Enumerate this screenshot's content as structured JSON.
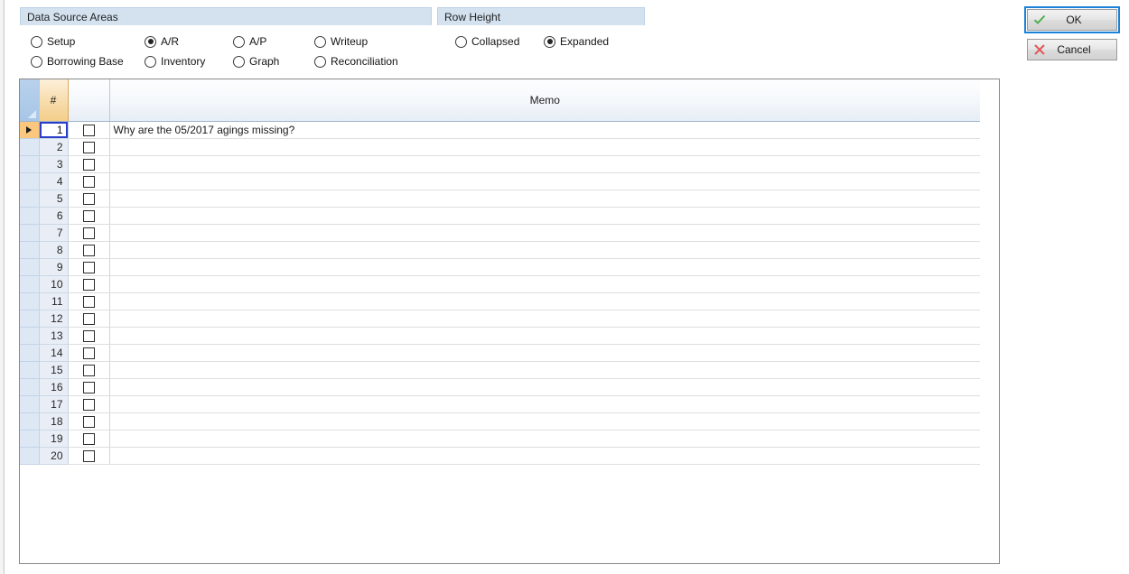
{
  "groups": {
    "data_source": {
      "caption": "Data Source Areas",
      "options": [
        {
          "label": "Setup",
          "checked": false
        },
        {
          "label": "A/R",
          "checked": true
        },
        {
          "label": "A/P",
          "checked": false
        },
        {
          "label": "Writeup",
          "checked": false
        },
        {
          "label": "Borrowing Base",
          "checked": false
        },
        {
          "label": "Inventory",
          "checked": false
        },
        {
          "label": "Graph",
          "checked": false
        },
        {
          "label": "Reconciliation",
          "checked": false
        }
      ]
    },
    "row_height": {
      "caption": "Row Height",
      "options": [
        {
          "label": "Collapsed",
          "checked": false
        },
        {
          "label": "Expanded",
          "checked": true
        }
      ]
    }
  },
  "buttons": {
    "ok": {
      "label": "OK",
      "icon": "check-icon",
      "icon_glyph": "✓",
      "icon_color": "#4caf50",
      "focused": true
    },
    "cancel": {
      "label": "Cancel",
      "icon": "x-icon",
      "icon_glyph": "✕",
      "icon_color": "#e0585b",
      "focused": false
    }
  },
  "grid": {
    "columns": [
      {
        "key": "indicator",
        "header": ""
      },
      {
        "key": "number",
        "header": "#"
      },
      {
        "key": "checkbox",
        "header": ""
      },
      {
        "key": "memo",
        "header": "Memo"
      }
    ],
    "current_row": 1,
    "rows": [
      {
        "number": "1",
        "checked": false,
        "memo": "Why are the 05/2017 agings missing?"
      },
      {
        "number": "2",
        "checked": false,
        "memo": ""
      },
      {
        "number": "3",
        "checked": false,
        "memo": ""
      },
      {
        "number": "4",
        "checked": false,
        "memo": ""
      },
      {
        "number": "5",
        "checked": false,
        "memo": ""
      },
      {
        "number": "6",
        "checked": false,
        "memo": ""
      },
      {
        "number": "7",
        "checked": false,
        "memo": ""
      },
      {
        "number": "8",
        "checked": false,
        "memo": ""
      },
      {
        "number": "9",
        "checked": false,
        "memo": ""
      },
      {
        "number": "10",
        "checked": false,
        "memo": ""
      },
      {
        "number": "11",
        "checked": false,
        "memo": ""
      },
      {
        "number": "12",
        "checked": false,
        "memo": ""
      },
      {
        "number": "13",
        "checked": false,
        "memo": ""
      },
      {
        "number": "14",
        "checked": false,
        "memo": ""
      },
      {
        "number": "15",
        "checked": false,
        "memo": ""
      },
      {
        "number": "16",
        "checked": false,
        "memo": ""
      },
      {
        "number": "17",
        "checked": false,
        "memo": ""
      },
      {
        "number": "18",
        "checked": false,
        "memo": ""
      },
      {
        "number": "19",
        "checked": false,
        "memo": ""
      },
      {
        "number": "20",
        "checked": false,
        "memo": ""
      }
    ]
  },
  "colors": {
    "group_caption_bg": "#d4e2f0",
    "row_header_orange": "#f3cd8a",
    "indicator_blue": "#aecbe9",
    "focus_blue": "#1a82d8",
    "selection_blue": "#2b3ec9"
  }
}
